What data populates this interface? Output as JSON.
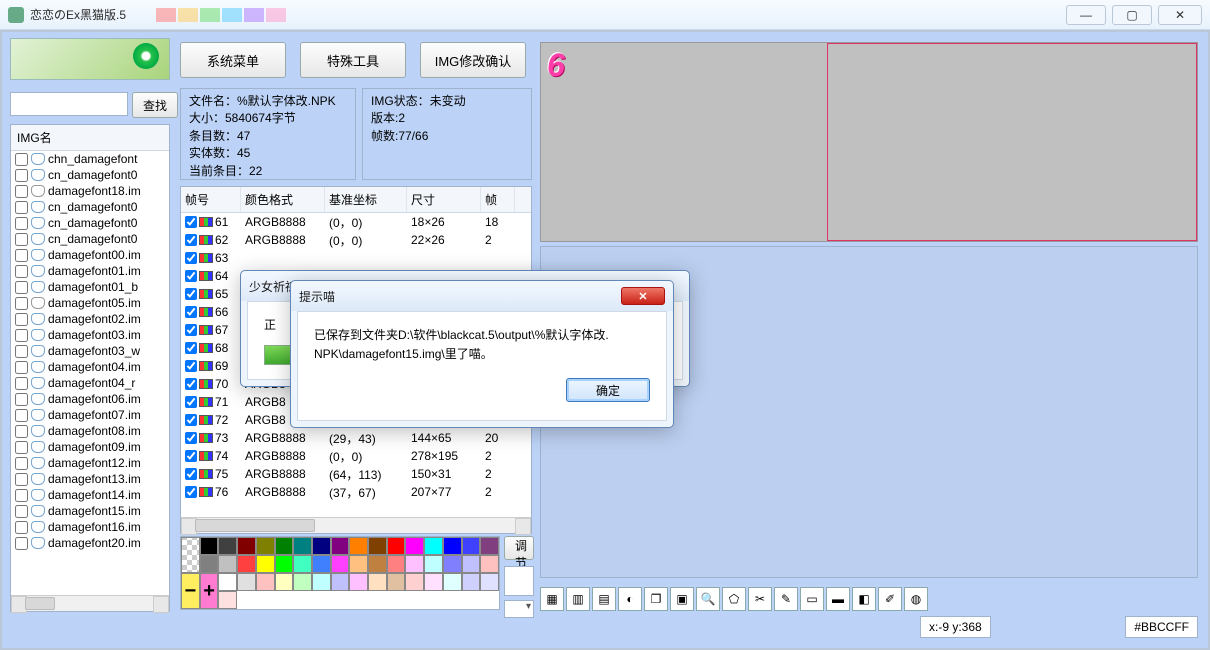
{
  "window": {
    "title": "恋恋のEx黑猫版.5"
  },
  "buttons": {
    "search": "查找",
    "system_menu": "系统菜单",
    "special_tools": "特殊工具",
    "img_confirm": "IMG修改确认",
    "adjust": "调节"
  },
  "filelist": {
    "header": "IMG名",
    "items": [
      {
        "name": "chn_damagefont",
        "gray": false
      },
      {
        "name": "cn_damagefont0",
        "gray": false
      },
      {
        "name": "damagefont18.im",
        "gray": true
      },
      {
        "name": "cn_damagefont0",
        "gray": false
      },
      {
        "name": "cn_damagefont0",
        "gray": false
      },
      {
        "name": "cn_damagefont0",
        "gray": false
      },
      {
        "name": "damagefont00.im",
        "gray": false
      },
      {
        "name": "damagefont01.im",
        "gray": false
      },
      {
        "name": "damagefont01_b",
        "gray": false
      },
      {
        "name": "damagefont05.im",
        "gray": true
      },
      {
        "name": "damagefont02.im",
        "gray": false
      },
      {
        "name": "damagefont03.im",
        "gray": false
      },
      {
        "name": "damagefont03_w",
        "gray": false
      },
      {
        "name": "damagefont04.im",
        "gray": false
      },
      {
        "name": "damagefont04_r",
        "gray": false
      },
      {
        "name": "damagefont06.im",
        "gray": false
      },
      {
        "name": "damagefont07.im",
        "gray": false
      },
      {
        "name": "damagefont08.im",
        "gray": false
      },
      {
        "name": "damagefont09.im",
        "gray": false
      },
      {
        "name": "damagefont12.im",
        "gray": false
      },
      {
        "name": "damagefont13.im",
        "gray": false
      },
      {
        "name": "damagefont14.im",
        "gray": false
      },
      {
        "name": "damagefont15.im",
        "gray": false
      },
      {
        "name": "damagefont16.im",
        "gray": false
      },
      {
        "name": "damagefont20.im",
        "gray": false
      }
    ]
  },
  "info1": {
    "l1": "文件名：%默认字体改.NPK",
    "l2": "大小：5840674字节",
    "l3": "条目数：47",
    "l4": "实体数：45",
    "l5": "当前条目：22"
  },
  "info2": {
    "l1": "IMG状态：未变动",
    "l2": "版本:2",
    "l3": "帧数:77/66"
  },
  "frametable": {
    "headers": {
      "c0": "帧号",
      "c1": "颜色格式",
      "c2": "基准坐标",
      "c3": "尺寸",
      "c4": "帧"
    },
    "rows": [
      {
        "id": "61",
        "fmt": "ARGB8888",
        "coord": "(0，0)",
        "size": "18×26",
        "extra": "18"
      },
      {
        "id": "62",
        "fmt": "ARGB8888",
        "coord": "(0，0)",
        "size": "22×26",
        "extra": "2"
      },
      {
        "id": "63",
        "fmt": "",
        "coord": "",
        "size": "",
        "extra": ""
      },
      {
        "id": "64",
        "fmt": "",
        "coord": "",
        "size": "",
        "extra": ""
      },
      {
        "id": "65",
        "fmt": "",
        "coord": "",
        "size": "",
        "extra": ""
      },
      {
        "id": "66",
        "fmt": "",
        "coord": "",
        "size": "",
        "extra": ""
      },
      {
        "id": "67",
        "fmt": "",
        "coord": "",
        "size": "",
        "extra": ""
      },
      {
        "id": "68",
        "fmt": "",
        "coord": "",
        "size": "",
        "extra": ""
      },
      {
        "id": "69",
        "fmt": "",
        "coord": "",
        "size": "",
        "extra": ""
      },
      {
        "id": "70",
        "fmt": "ARGB8",
        "coord": "",
        "size": "",
        "extra": ""
      },
      {
        "id": "71",
        "fmt": "ARGB8",
        "coord": "",
        "size": "",
        "extra": ""
      },
      {
        "id": "72",
        "fmt": "ARGB8",
        "coord": "",
        "size": "",
        "extra": ""
      },
      {
        "id": "73",
        "fmt": "ARGB8888",
        "coord": "(29，43)",
        "size": "144×65",
        "extra": "20"
      },
      {
        "id": "74",
        "fmt": "ARGB8888",
        "coord": "(0，0)",
        "size": "278×195",
        "extra": "2"
      },
      {
        "id": "75",
        "fmt": "ARGB8888",
        "coord": "(64，113)",
        "size": "150×31",
        "extra": "2"
      },
      {
        "id": "76",
        "fmt": "ARGB8888",
        "coord": "(37，67)",
        "size": "207×77",
        "extra": "2"
      }
    ]
  },
  "palette_colors": [
    "#000000",
    "#404040",
    "#800000",
    "#808000",
    "#008000",
    "#008080",
    "#000080",
    "#800080",
    "#ff8000",
    "#804000",
    "#ff0000",
    "#ff00ff",
    "#00ffff",
    "#0000ff",
    "#4040ff",
    "#804080",
    "#808080",
    "#c0c0c0",
    "#ff4040",
    "#ffff00",
    "#00ff00",
    "#40ffc0",
    "#4080ff",
    "#ff40ff",
    "#ffc080",
    "#c08040",
    "#ff8080",
    "#ffc0ff",
    "#c0ffff",
    "#8080ff",
    "#c0c0ff",
    "#ffc0c0",
    "#ffffff",
    "#e0e0e0",
    "#ffc0c0",
    "#ffffc0",
    "#c0ffc0",
    "#c0ffff",
    "#c0c0ff",
    "#ffc0ff",
    "#ffe0c0",
    "#e0c0a0",
    "#ffd0d0",
    "#ffe0ff",
    "#e0ffff",
    "#d0d0ff",
    "#e0e0ff",
    "#ffe0e0"
  ],
  "canvas": {
    "glyph": "6"
  },
  "toolbar_icons": [
    "grid",
    "swap",
    "film",
    "cat",
    "layers",
    "stack",
    "zoom",
    "poly",
    "crop",
    "pen",
    "rect",
    "rect2",
    "eraser",
    "picker",
    "fill"
  ],
  "status": {
    "coord": "x:-9 y:368",
    "color": "#BBCCFF"
  },
  "dialog_progress": {
    "title": "少女祈祷",
    "label": "正"
  },
  "dialog_alert": {
    "title": "提示喵",
    "message_l1": "已保存到文件夹D:\\软件\\blackcat.5\\output\\%默认字体改.",
    "message_l2": "NPK\\damagefont15.img\\里了喵。",
    "ok": "确定"
  }
}
